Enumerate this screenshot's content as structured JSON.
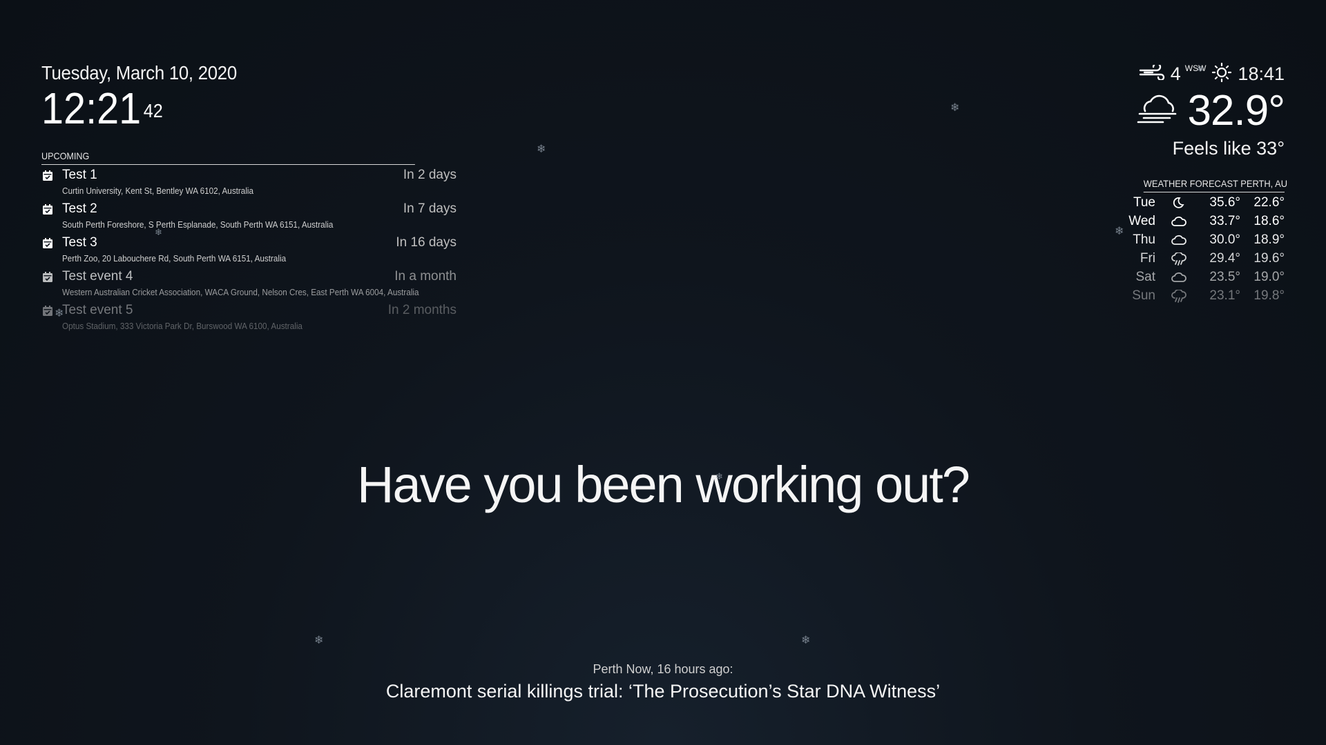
{
  "clock": {
    "date": "Tuesday, March 10, 2020",
    "time": "12:21",
    "seconds": "42"
  },
  "calendar": {
    "header": "UPCOMING",
    "events": [
      {
        "title": "Test 1",
        "when": "In 2 days",
        "location": "Curtin University, Kent St, Bentley WA 6102, Australia",
        "opacity": 1.0
      },
      {
        "title": "Test 2",
        "when": "In 7 days",
        "location": "South Perth Foreshore, S Perth Esplanade, South Perth WA 6151, Australia",
        "opacity": 1.0
      },
      {
        "title": "Test 3",
        "when": "In 16 days",
        "location": "Perth Zoo, 20 Labouchere Rd, South Perth WA 6151, Australia",
        "opacity": 1.0
      },
      {
        "title": "Test event 4",
        "when": "In a month",
        "location": "Western Australian Cricket Association, WACA Ground, Nelson Cres, East Perth WA 6004, Australia",
        "opacity": 0.72
      },
      {
        "title": "Test event 5",
        "when": "In 2 months",
        "location": "Optus Stadium, 333 Victoria Park Dr, Burswood WA 6100, Australia",
        "opacity": 0.42
      }
    ]
  },
  "current_weather": {
    "wind_speed": "4",
    "wind_direction": "WSW",
    "sunset_time": "18:41",
    "temperature": "32.9°",
    "feels_like": "Feels like 33°",
    "icons": {
      "wind": "wind-icon",
      "sun": "sunset-icon",
      "condition": "cloudy-windy-icon"
    }
  },
  "forecast": {
    "header": "WEATHER FORECAST PERTH, AU",
    "days": [
      {
        "day": "Tue",
        "icon": "moon-icon",
        "max": "35.6°",
        "min": "22.6°",
        "opacity": 1.0
      },
      {
        "day": "Wed",
        "icon": "cloud-icon",
        "max": "33.7°",
        "min": "18.6°",
        "opacity": 1.0
      },
      {
        "day": "Thu",
        "icon": "cloud-icon",
        "max": "30.0°",
        "min": "18.9°",
        "opacity": 0.92
      },
      {
        "day": "Fri",
        "icon": "rain-icon",
        "max": "29.4°",
        "min": "19.6°",
        "opacity": 0.82
      },
      {
        "day": "Sat",
        "icon": "cloud-icon",
        "max": "23.5°",
        "min": "19.0°",
        "opacity": 0.62
      },
      {
        "day": "Sun",
        "icon": "rain-icon",
        "max": "23.1°",
        "min": "19.8°",
        "opacity": 0.42
      }
    ]
  },
  "compliment": {
    "text": "Have you been working out?"
  },
  "news": {
    "source": "Perth Now, 16 hours ago:",
    "headline": "Claremont serial killings trial: ‘The Prosecution’s Star DNA Witness’"
  },
  "colors": {
    "background": "#0f151d",
    "text": "#ffffff",
    "dim_text": "#bfbfbf",
    "snowflake": "#8f9aa6"
  }
}
